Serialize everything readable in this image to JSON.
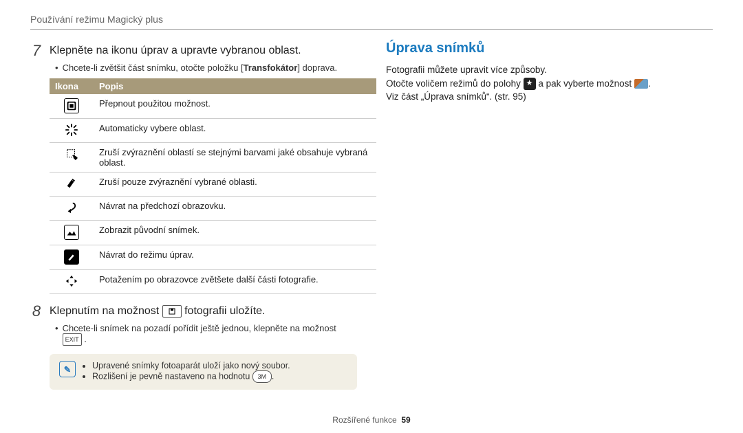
{
  "breadcrumb": "Používání režimu Magický plus",
  "left": {
    "step7_num": "7",
    "step7_text": "Klepněte na ikonu úprav a upravte vybranou oblast.",
    "step7_bullet_a": "Chcete-li zvětšit část snímku, otočte položku [",
    "step7_bullet_b": "Transfokátor",
    "step7_bullet_c": "] doprava.",
    "th_icon": "Ikona",
    "th_desc": "Popis",
    "rows": [
      {
        "desc": "Přepnout použitou možnost."
      },
      {
        "desc": "Automaticky vybere oblast."
      },
      {
        "desc": "Zruší zvýraznění oblastí se stejnými barvami jaké obsahuje vybraná oblast."
      },
      {
        "desc": "Zruší pouze zvýraznění vybrané oblasti."
      },
      {
        "desc": "Návrat na předchozí obrazovku."
      },
      {
        "desc": "Zobrazit původní snímek."
      },
      {
        "desc": "Návrat do režimu úprav."
      },
      {
        "desc": "Potažením po obrazovce zvětšete další části fotografie."
      }
    ],
    "step8_num": "8",
    "step8_a": "Klepnutím na možnost ",
    "step8_b": " fotografii uložíte.",
    "step8_bullet_a": "Chcete-li snímek na pozadí pořídit ještě jednou, klepněte na možnost ",
    "exit_label": "EXIT",
    "note1": "Upravené snímky fotoaparát uloží jako nový soubor.",
    "note2_a": "Rozlišení je pevně nastaveno na hodnotu ",
    "note2_badge": "3M"
  },
  "right": {
    "heading": "Úprava snímků",
    "p1": "Fotografii můžete upravit více způsoby.",
    "p2a": "Otočte voličem režimů do polohy ",
    "p2b": " a pak vyberte možnost ",
    "p3": "Viz část „Úprava snímků“. (str. 95)"
  },
  "footer_label": "Rozšířené funkce",
  "footer_page": "59"
}
